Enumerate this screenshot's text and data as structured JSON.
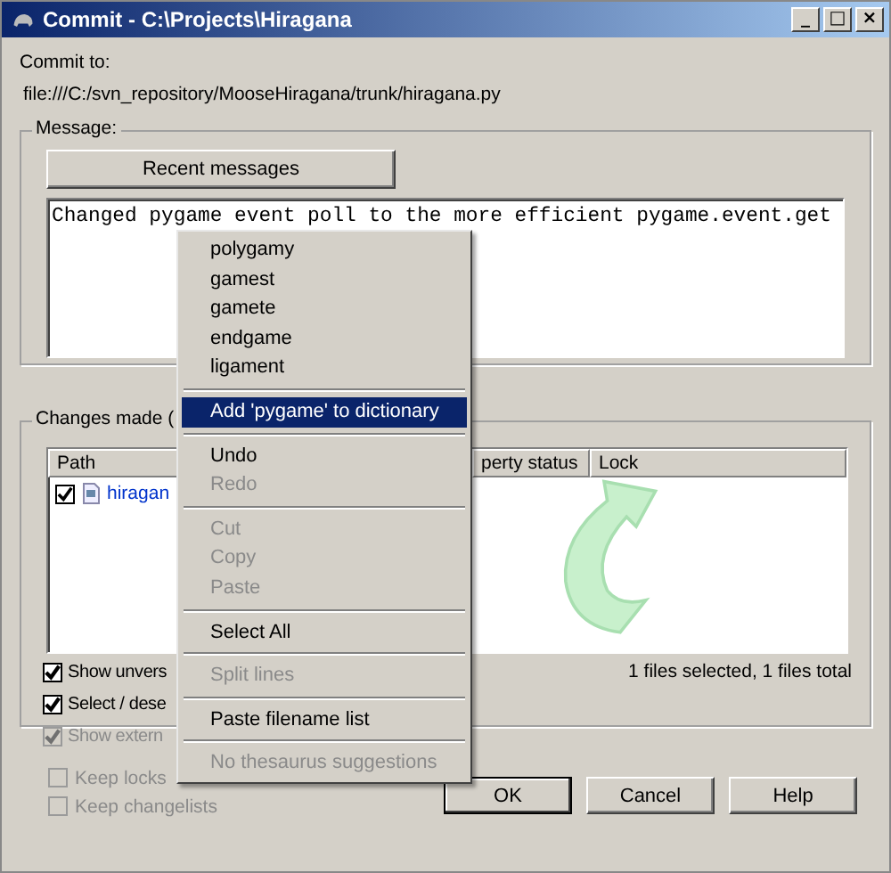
{
  "window": {
    "title": "Commit - C:\\Projects\\Hiragana",
    "controls": [
      "_",
      "□",
      "×"
    ]
  },
  "commit_to": {
    "label": "Commit to:",
    "url": "file:///C:/svn_repository/MooseHiragana/trunk/hiragana.py"
  },
  "message": {
    "label": "Message:",
    "recent_button": "Recent messages",
    "text": "Changed pygame event poll to the more efficient pygame.event.get"
  },
  "changes": {
    "label": "Changes made (",
    "columns": [
      "Path",
      "perty status",
      "Lock"
    ],
    "rows": [
      {
        "checked": true,
        "path": "hiragan"
      }
    ],
    "options": [
      {
        "label": "Show unvers",
        "checked": true,
        "disabled": false
      },
      {
        "label": "Select / dese",
        "checked": true,
        "disabled": false
      },
      {
        "label": "Show extern",
        "checked": true,
        "disabled": true
      }
    ],
    "status": "1 files selected, 1 files total"
  },
  "keep_options": [
    {
      "label": "Keep locks",
      "checked": false,
      "disabled": true
    },
    {
      "label": "Keep changelists",
      "checked": false,
      "disabled": true
    }
  ],
  "buttons": [
    {
      "label": "OK",
      "default": true
    },
    {
      "label": "Cancel",
      "default": false
    },
    {
      "label": "Help",
      "default": false
    }
  ],
  "context_menu": [
    {
      "kind": "item",
      "label": "polygamy",
      "disabled": false,
      "selected": false
    },
    {
      "kind": "item",
      "label": "gamest",
      "disabled": false,
      "selected": false
    },
    {
      "kind": "item",
      "label": "gamete",
      "disabled": false,
      "selected": false
    },
    {
      "kind": "item",
      "label": "endgame",
      "disabled": false,
      "selected": false
    },
    {
      "kind": "item",
      "label": "ligament",
      "disabled": false,
      "selected": false
    },
    {
      "kind": "separator"
    },
    {
      "kind": "item",
      "label": "Add 'pygame' to dictionary",
      "disabled": false,
      "selected": true
    },
    {
      "kind": "separator"
    },
    {
      "kind": "item",
      "label": "Undo",
      "disabled": false,
      "selected": false
    },
    {
      "kind": "item",
      "label": "Redo",
      "disabled": true,
      "selected": false
    },
    {
      "kind": "separator"
    },
    {
      "kind": "item",
      "label": "Cut",
      "disabled": true,
      "selected": false
    },
    {
      "kind": "item",
      "label": "Copy",
      "disabled": true,
      "selected": false
    },
    {
      "kind": "item",
      "label": "Paste",
      "disabled": true,
      "selected": false
    },
    {
      "kind": "separator"
    },
    {
      "kind": "item",
      "label": "Select All",
      "disabled": false,
      "selected": false
    },
    {
      "kind": "separator"
    },
    {
      "kind": "item",
      "label": "Split lines",
      "disabled": true,
      "selected": false
    },
    {
      "kind": "separator"
    },
    {
      "kind": "item",
      "label": "Paste filename list",
      "disabled": false,
      "selected": false
    },
    {
      "kind": "separator"
    },
    {
      "kind": "item",
      "label": "No thesaurus suggestions",
      "disabled": true,
      "selected": false
    }
  ]
}
